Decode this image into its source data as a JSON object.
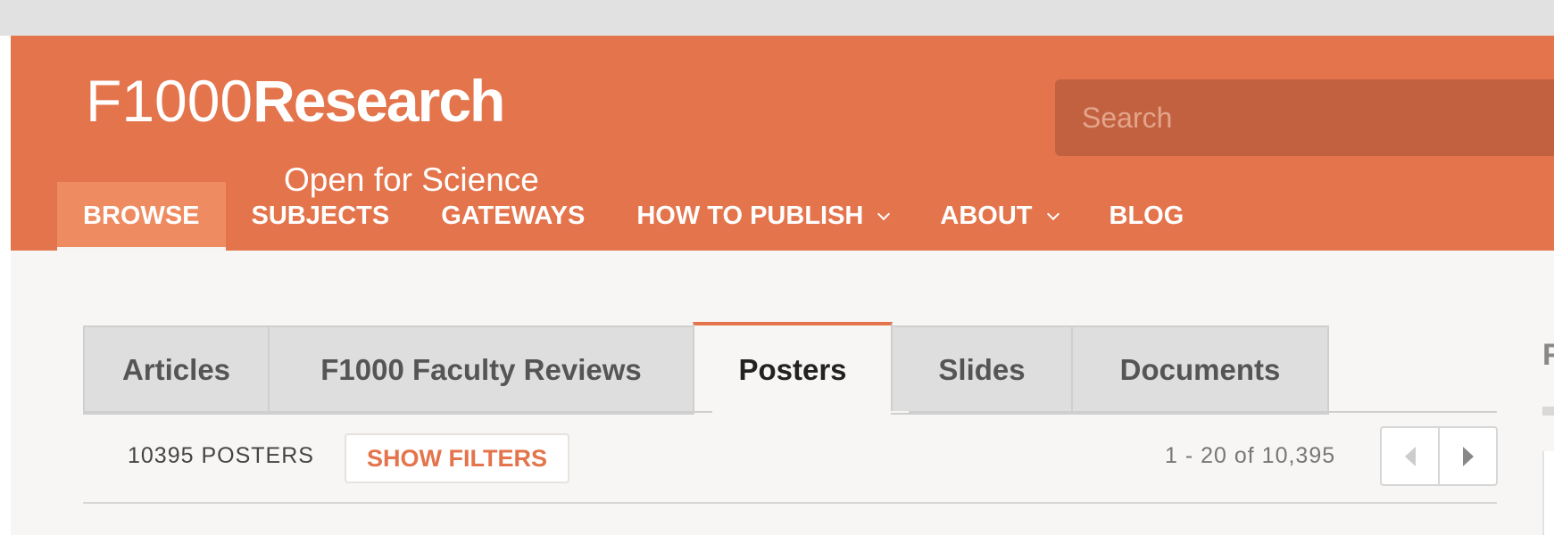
{
  "brand": {
    "logo_prefix": "F1000",
    "logo_bold": "Research",
    "tagline": "Open for Science",
    "accent_color": "#e4744b"
  },
  "search": {
    "placeholder": "Search"
  },
  "nav": {
    "items": [
      {
        "label": "BROWSE",
        "active": true
      },
      {
        "label": "SUBJECTS"
      },
      {
        "label": "GATEWAYS"
      },
      {
        "label": "HOW TO PUBLISH",
        "dropdown": true
      },
      {
        "label": "ABOUT",
        "dropdown": true
      },
      {
        "label": "BLOG"
      }
    ]
  },
  "tabs": [
    {
      "label": "Articles"
    },
    {
      "label": "F1000 Faculty Reviews"
    },
    {
      "label": "Posters",
      "active": true
    },
    {
      "label": "Slides"
    },
    {
      "label": "Documents"
    }
  ],
  "results": {
    "count_label": "10395 POSTERS",
    "show_filters_label": "SHOW FILTERS",
    "range_label": "1 - 20 of 10,395"
  },
  "sidebar": {
    "heading_fragment": "F"
  }
}
